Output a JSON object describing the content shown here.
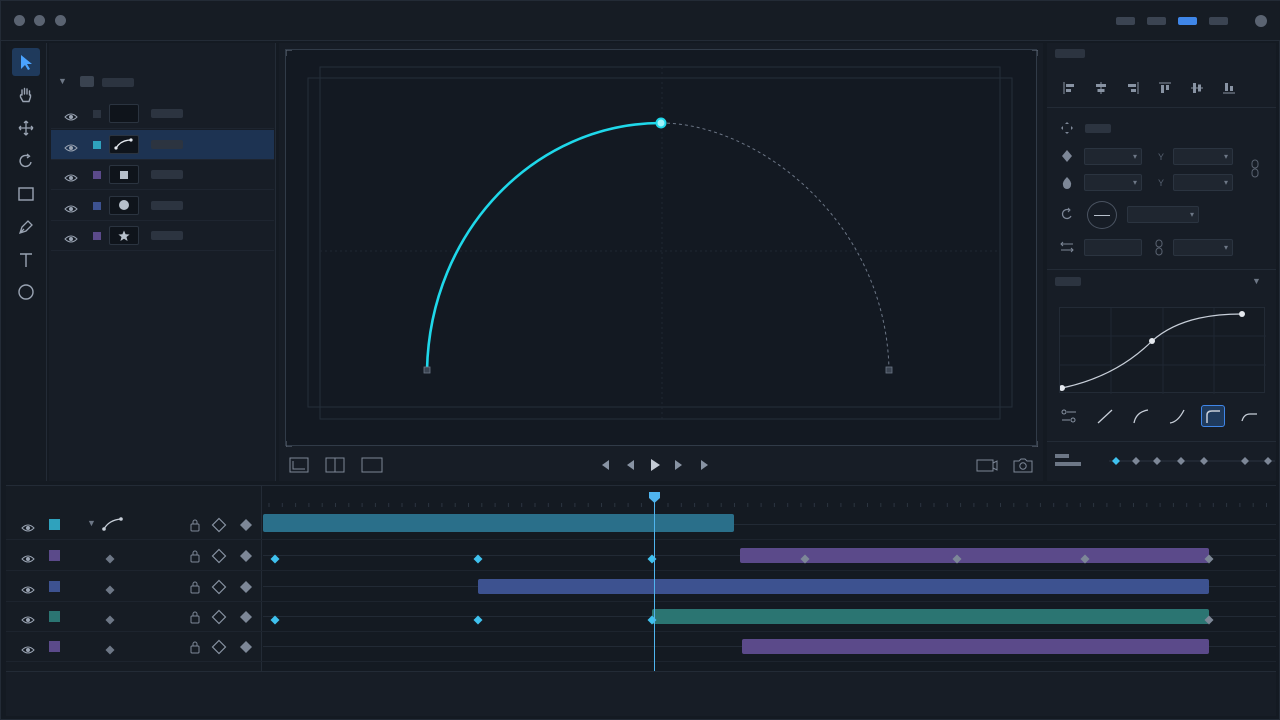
{
  "window": {
    "traffic_lights": [
      "close",
      "minimize",
      "maximize"
    ],
    "view_toggles": [
      {
        "name": "view-1",
        "active": false
      },
      {
        "name": "view-2",
        "active": false
      },
      {
        "name": "view-3",
        "active": true
      },
      {
        "name": "view-4",
        "active": false
      }
    ]
  },
  "colors": {
    "accent": "#3f86e8",
    "path": "#1fd8ea",
    "keyframe": "#3fc1ee",
    "playhead": "#4fb4ee",
    "track_teal_blue": "#2a6f8a",
    "track_purple": "#5b4a8a",
    "track_blue": "#3d5290",
    "track_teal": "#2b7572"
  },
  "tools": [
    {
      "name": "select-tool",
      "icon": "arrow-cursor-icon",
      "active": true
    },
    {
      "name": "hand-tool",
      "icon": "hand-icon",
      "active": false
    },
    {
      "name": "move-tool",
      "icon": "move-arrows-icon",
      "active": false
    },
    {
      "name": "rotate-tool",
      "icon": "rotate-icon",
      "active": false
    },
    {
      "name": "rectangle-tool",
      "icon": "rectangle-icon",
      "active": false
    },
    {
      "name": "pen-tool",
      "icon": "pen-icon",
      "active": false
    },
    {
      "name": "text-tool",
      "icon": "text-T-icon",
      "active": false
    },
    {
      "name": "ellipse-tool",
      "icon": "circle-icon",
      "active": false
    }
  ],
  "layers": {
    "group": {
      "expanded": true,
      "icon": "folder-icon"
    },
    "items": [
      {
        "name": "layer-empty",
        "visible": true,
        "swatch": "#2c3440",
        "thumb": "empty",
        "selected": false
      },
      {
        "name": "layer-path",
        "visible": true,
        "swatch": "#2fa2bd",
        "thumb": "path",
        "selected": true
      },
      {
        "name": "layer-square",
        "visible": true,
        "swatch": "#5b4a8a",
        "thumb": "square",
        "selected": false
      },
      {
        "name": "layer-circle",
        "visible": true,
        "swatch": "#3d5290",
        "thumb": "circle",
        "selected": false
      },
      {
        "name": "layer-star",
        "visible": true,
        "swatch": "#5b4a8a",
        "thumb": "star",
        "selected": false
      }
    ]
  },
  "viewport": {
    "controls_left": [
      "frame-view-icon",
      "split-view-icon",
      "single-view-icon"
    ],
    "transport": [
      "skip-back-icon",
      "step-back-icon",
      "play-icon",
      "step-forward-icon",
      "skip-forward-icon"
    ],
    "controls_right": [
      "camera-icon",
      "snapshot-icon"
    ]
  },
  "inspector": {
    "align": [
      "align-left-icon",
      "align-center-h-icon",
      "align-right-icon",
      "align-top-icon",
      "align-center-v-icon",
      "align-bottom-icon"
    ],
    "easing_presets": [
      "easing-settings-icon",
      "linear-icon",
      "ease-in-icon",
      "ease-out-icon",
      "ease-in-out-icon",
      "ease-flat-icon"
    ],
    "active_easing": 4,
    "xy_label": "Y"
  },
  "timeline": {
    "playhead_fraction": 0.386,
    "tracks": [
      {
        "name": "track-path",
        "swatch": "#2fa2bd",
        "expanded": true
      },
      {
        "name": "track-square",
        "swatch": "#5b4a8a",
        "expanded": false
      },
      {
        "name": "track-circle",
        "swatch": "#3d5290",
        "expanded": false
      },
      {
        "name": "track-teal",
        "swatch": "#2b7572",
        "expanded": false
      },
      {
        "name": "track-star",
        "swatch": "#5b4a8a",
        "expanded": false
      }
    ]
  }
}
